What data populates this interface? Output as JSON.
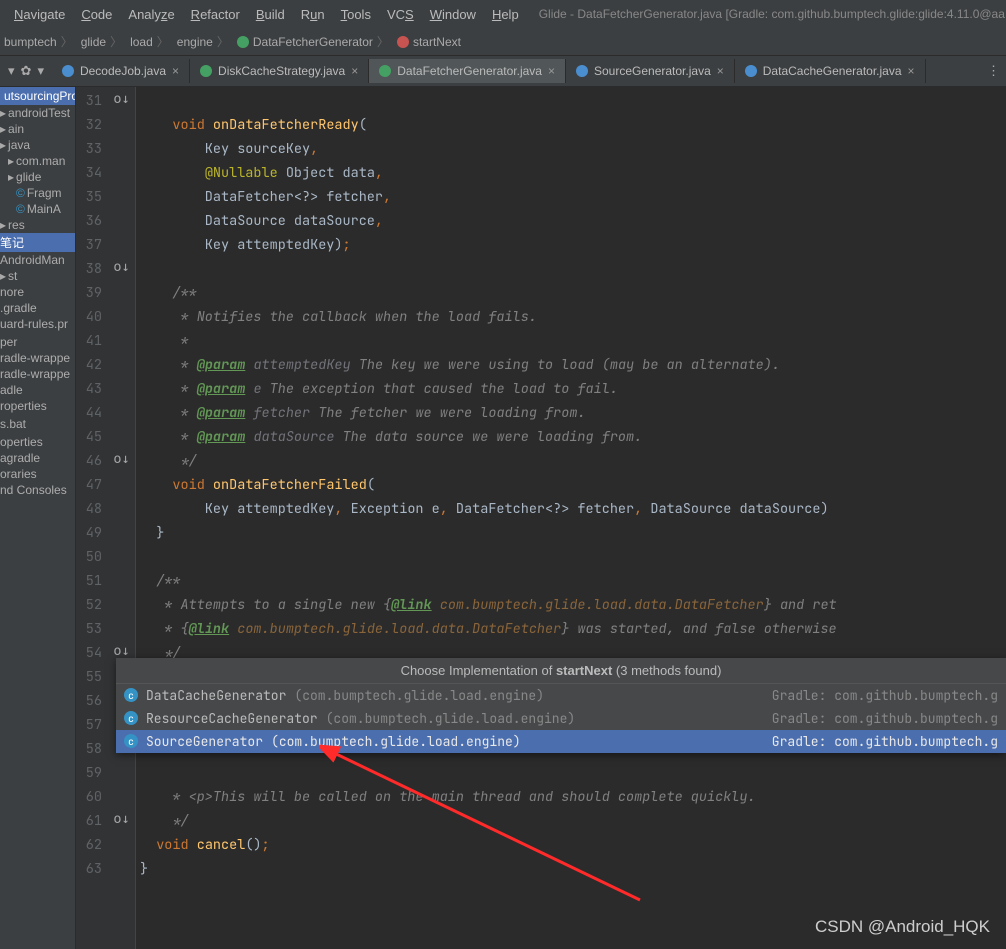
{
  "title": "Glide - DataFetcherGenerator.java [Gradle: com.github.bumptech.glide:glide:4.11.0@aa",
  "menus": [
    "Navigate",
    "Code",
    "Analyze",
    "Refactor",
    "Build",
    "Run",
    "Tools",
    "VCS",
    "Window",
    "Help"
  ],
  "breadcrumbs": [
    "bumptech",
    "glide",
    "load",
    "engine",
    "DataFetcherGenerator",
    "startNext"
  ],
  "tabs": [
    {
      "label": "DecodeJob.java",
      "icon": "b",
      "active": false
    },
    {
      "label": "DiskCacheStrategy.java",
      "icon": "g",
      "active": false
    },
    {
      "label": "DataFetcherGenerator.java",
      "icon": "g",
      "active": true
    },
    {
      "label": "SourceGenerator.java",
      "icon": "b",
      "active": false
    },
    {
      "label": "DataCacheGenerator.java",
      "icon": "b",
      "active": false
    }
  ],
  "sidebar": {
    "top": "utsourcingPro",
    "items": [
      {
        "t": "androidTest",
        "k": "fd"
      },
      {
        "t": "ain",
        "k": "fd"
      },
      {
        "t": "java",
        "k": "fd"
      },
      {
        "t": "com.man",
        "k": "fd",
        "i": 1
      },
      {
        "t": "glide",
        "k": "fd",
        "i": 1
      },
      {
        "t": "Fragm",
        "k": "c",
        "i": 2
      },
      {
        "t": "MainA",
        "k": "c",
        "i": 2
      },
      {
        "t": "res",
        "k": "fd"
      },
      {
        "t": "笔记",
        "k": "sel"
      },
      {
        "t": "AndroidMan",
        "k": "f"
      },
      {
        "t": "st",
        "k": "fd"
      },
      {
        "t": "nore",
        "k": "f"
      },
      {
        "t": ".gradle",
        "k": "f"
      },
      {
        "t": "uard-rules.pr",
        "k": "f"
      },
      {
        "t": "",
        "k": "f"
      },
      {
        "t": "per",
        "k": "f"
      },
      {
        "t": "radle-wrappe",
        "k": "f"
      },
      {
        "t": "radle-wrappe",
        "k": "f"
      },
      {
        "t": "adle",
        "k": "f"
      },
      {
        "t": "roperties",
        "k": "f"
      },
      {
        "t": "",
        "k": "f"
      },
      {
        "t": "s.bat",
        "k": "f"
      },
      {
        "t": "",
        "k": "f"
      },
      {
        "t": "operties",
        "k": "f"
      },
      {
        "t": "agradle",
        "k": "f"
      },
      {
        "t": "oraries",
        "k": "f"
      },
      {
        "t": "nd Consoles",
        "k": "f"
      }
    ]
  },
  "lines": {
    "start": 31,
    "end": 63,
    "markers": {
      "31": "o",
      "38": "o",
      "46": "o",
      "54": "o",
      "61": "o"
    }
  },
  "popup": {
    "title_pre": "Choose Implementation of ",
    "title_bold": "startNext",
    "title_post": " (3 methods found)",
    "rows": [
      {
        "cls": "DataCacheGenerator",
        "pkg": "(com.bumptech.glide.load.engine)",
        "grd": "Gradle: com.github.bumptech.g",
        "sel": false
      },
      {
        "cls": "ResourceCacheGenerator",
        "pkg": "(com.bumptech.glide.load.engine)",
        "grd": "Gradle: com.github.bumptech.g",
        "sel": false
      },
      {
        "cls": "SourceGenerator",
        "pkg": "(com.bumptech.glide.load.engine)",
        "grd": "Gradle: com.github.bumptech.g",
        "sel": true
      }
    ]
  },
  "watermark": "CSDN @Android_HQK"
}
